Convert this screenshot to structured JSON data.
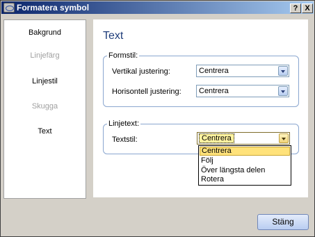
{
  "window": {
    "title": "Formatera symbol",
    "help_button": "?",
    "close_button": "X"
  },
  "nav": {
    "items": [
      {
        "label": "Bakgrund",
        "enabled": true
      },
      {
        "label": "Linjefärg",
        "enabled": false
      },
      {
        "label": "Linjestil",
        "enabled": true
      },
      {
        "label": "Skugga",
        "enabled": false
      },
      {
        "label": "Text",
        "enabled": true
      }
    ]
  },
  "panel": {
    "title": "Text",
    "formstil": {
      "label": "Formstil:",
      "vertikal_label": "Vertikal justering:",
      "vertikal_value": "Centrera",
      "horisontell_label": "Horisontell justering:",
      "horisontell_value": "Centrera"
    },
    "linjetext": {
      "label": "Linjetext:",
      "textstil_label": "Textstil:",
      "textstil_value": "Centrera",
      "options": [
        "Centrera",
        "Följ",
        "Över längsta delen",
        "Rotera"
      ],
      "selected_option": "Centrera"
    }
  },
  "footer": {
    "close_label": "Stäng"
  },
  "colors": {
    "titlebar_start": "#0a246a",
    "titlebar_end": "#a6caf0",
    "panel_title": "#1f3d7a",
    "group_border": "#8aa6cf",
    "selected_option_bg": "#ffe27a"
  }
}
